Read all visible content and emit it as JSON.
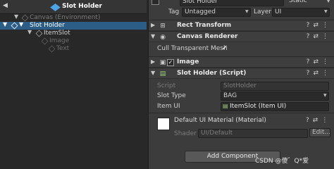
{
  "hierarchy": {
    "title": "Slot Holder",
    "rows": [
      {
        "label": "Canvas (Environment)"
      },
      {
        "label": "Slot Holder"
      },
      {
        "label": "ItemSlot"
      },
      {
        "label": "Image"
      },
      {
        "label": "Text"
      }
    ]
  },
  "inspector": {
    "object_name": "Slot Holder",
    "static_label": "Static",
    "tag_label": "Tag",
    "tag_value": "Untagged",
    "layer_label": "Layer",
    "layer_value": "UI",
    "components": {
      "rect_transform": "Rect Transform",
      "canvas_renderer": "Canvas Renderer",
      "image": "Image",
      "slot_holder_script": "Slot Holder (Script)"
    },
    "cull_label": "Cull Transparent Mesh",
    "cull_checked": "✓",
    "script_label": "Script",
    "script_value": "SlotHolder",
    "slot_type_label": "Slot Type",
    "slot_type_value": "BAG",
    "item_ui_label": "Item UI",
    "item_ui_value": "ItemSlot (Item UI)",
    "material_title": "Default UI Material (Material)",
    "shader_label": "Shader",
    "shader_value": "UI/Default",
    "edit_label": "Edit...",
    "add_component": "Add Component",
    "watermark": "CSDN @傻゛Q*爱"
  }
}
